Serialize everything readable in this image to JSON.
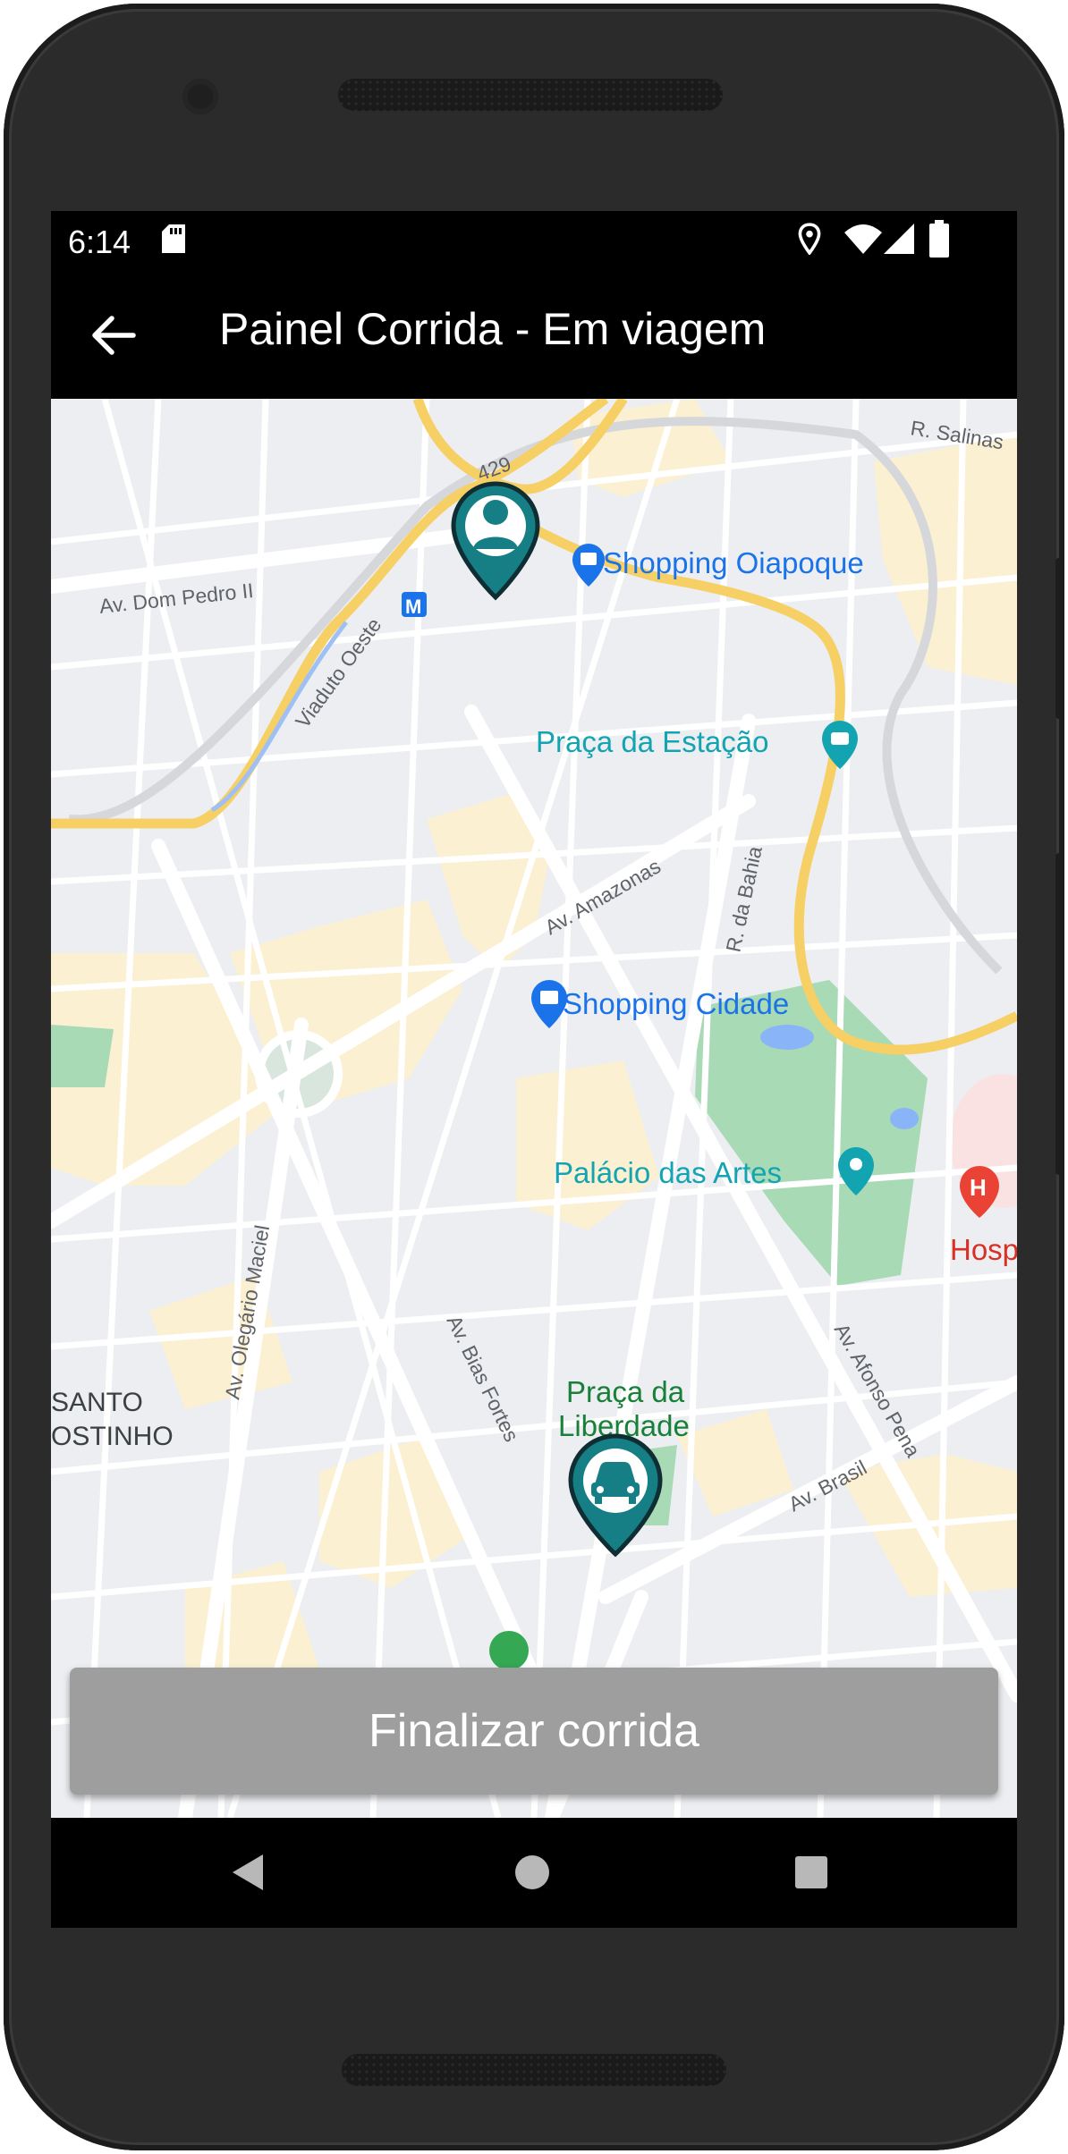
{
  "status_bar": {
    "time": "6:14",
    "icons": [
      "sd-card-icon",
      "location-icon",
      "wifi-icon",
      "signal-icon",
      "battery-icon"
    ]
  },
  "app_bar": {
    "back_icon": "arrow-back-icon",
    "title": "Painel Corrida - Em viagem"
  },
  "map": {
    "streets": {
      "r_salinas": "R. Salinas",
      "av_dom_pedro": "Av. Dom Pedro II",
      "route_429": "429",
      "viaduto_oeste": "Viaduto Oeste",
      "av_amazonas": "Av. Amazonas",
      "r_da_bahia": "R. da Bahia",
      "av_olegario": "Av. Olegário Maciel",
      "av_bias_fortes": "Av. Bias Fortes",
      "av_afonso_pena": "Av. Afonso Pena",
      "av_brasil": "Av. Brasil"
    },
    "places": {
      "shopping_oiapoque": "Shopping Oiapoque",
      "praca_estacao": "Praça da Estação",
      "shopping_cidade": "Shopping Cidade",
      "palacio_artes": "Palácio das Artes",
      "hospital": "Hospi",
      "praca_liberdade_1": "Praça da",
      "praca_liberdade_2": "Liberdade",
      "santo_1": "SANTO",
      "santo_2": "OSTINHO",
      "metro_letter": "M",
      "hospital_letter": "H"
    },
    "markers": {
      "passenger": "person-pin-icon",
      "driver": "car-pin-icon"
    },
    "colors": {
      "map_bg": "#eceef1",
      "highway": "#f6cf65",
      "park": "#a8dab5",
      "marker": "#167f86",
      "poi_blue": "#1a73e8",
      "poi_teal": "#12a4b0",
      "poi_green": "#188038"
    }
  },
  "actions": {
    "finish_ride": "Finalizar corrida"
  },
  "nav_bar": {
    "back": "nav-back-icon",
    "home": "nav-home-icon",
    "recents": "nav-recents-icon"
  }
}
